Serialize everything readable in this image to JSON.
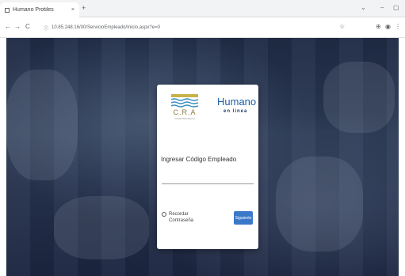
{
  "browser": {
    "tab_title": "Humano Protiles",
    "tab_close": "×",
    "new_tab": "+",
    "window_controls": [
      "⌄",
      "–",
      "▢"
    ],
    "nav": {
      "back": "←",
      "forward": "→",
      "reload": "C"
    },
    "url": "10.85.248.16/00/ServicioEmpleado/Inicio.aspx?e=0",
    "toolbar_icons": [
      "bookmark-star-icon",
      "extensions-icon",
      "profile-icon",
      "menu-icon"
    ]
  },
  "login": {
    "cra_logo_text": "C.R.A",
    "cra_logo_subtext": "COMPAÑÍA RIEGO",
    "humano_logo_main": "Humano",
    "humano_logo_sub": "en linea",
    "prompt": "Ingresar Código Empleado",
    "code_value": "",
    "remember_label_1": "Recordar",
    "remember_label_2": "Contraseña",
    "next_button": "Siguiente"
  },
  "colors": {
    "accent": "#3a78c9",
    "background": "#1f2b45",
    "humano_blue": "#1a5ea8"
  }
}
